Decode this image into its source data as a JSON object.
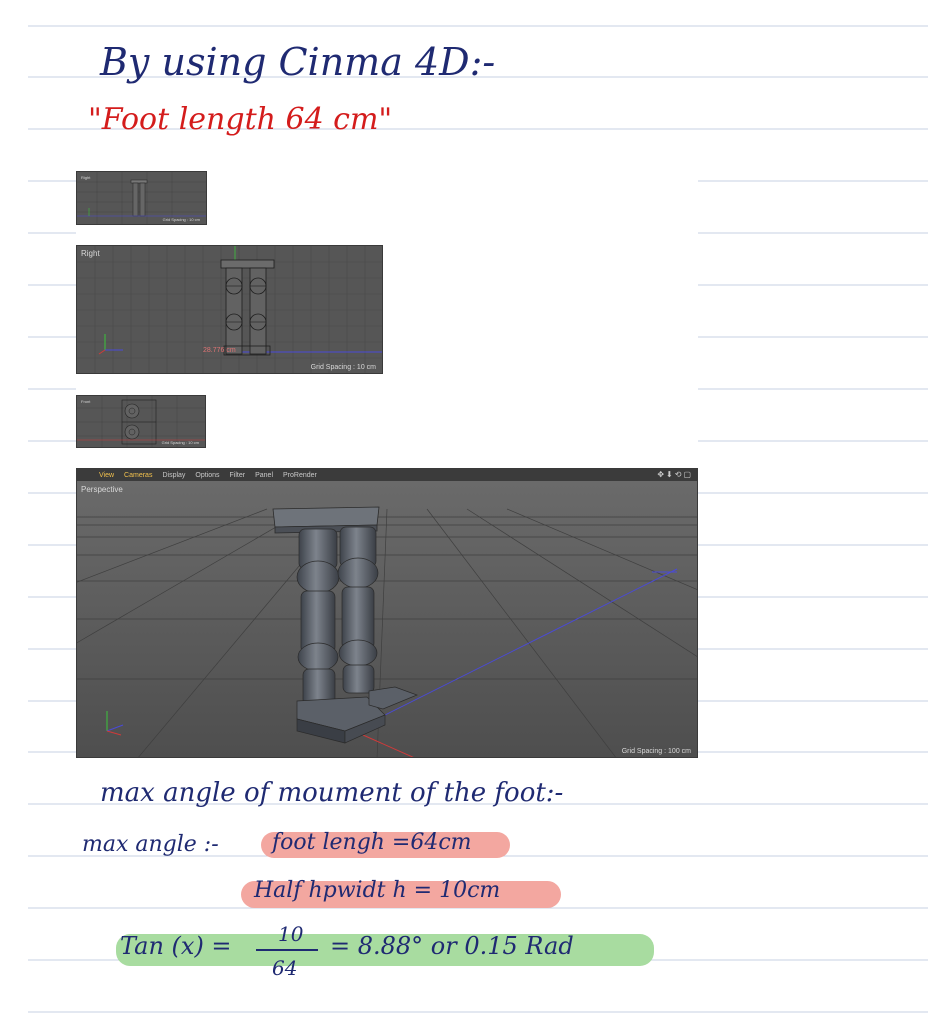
{
  "notes": {
    "heading": "By using   Cinma 4D:-",
    "subheading": "\"Foot  length 64 cm\""
  },
  "viewports": {
    "right_small": {
      "label": "Right",
      "grid": "Grid Spacing : 10 cm"
    },
    "right": {
      "label": "Right",
      "measure": "28.776 cm",
      "grid": "Grid Spacing : 10 cm"
    },
    "front_small": {
      "label": "Front",
      "grid": "Grid Spacing : 10 cm"
    },
    "perspective": {
      "menu": [
        "View",
        "Cameras",
        "Display",
        "Options",
        "Filter",
        "Panel",
        "ProRender"
      ],
      "label": "Perspective",
      "grid": "Grid Spacing : 100 cm"
    }
  },
  "calc": {
    "title": "max angle of moument of the foot:-",
    "line1_prefix": "max angle :-",
    "line1_highlight": "foot  lengh =64cm",
    "line2_highlight": "Half  hpwidt h = 10cm",
    "eq_lhs": "Tan (x) =",
    "eq_num": "10",
    "eq_den": "64",
    "eq_rhs": "=  8.88° or  0.15  Rad"
  },
  "colors": {
    "ink": "#1f2a72",
    "red_ink": "#d41c1c",
    "rule": "#c7d0e3",
    "highlight_red": "#f3a7a0",
    "highlight_green": "#a8dca0"
  }
}
